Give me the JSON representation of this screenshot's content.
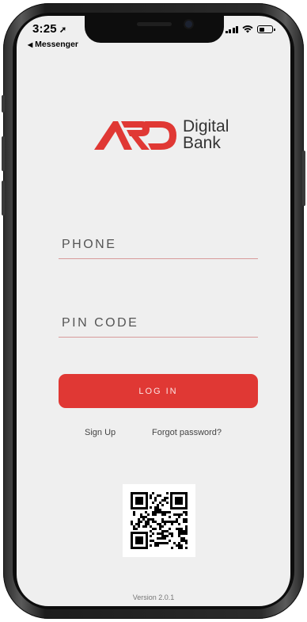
{
  "status_bar": {
    "time": "3:25",
    "location_arrow": "➚",
    "back_indicator": "◀",
    "back_app": "Messenger",
    "signal_icon": "cellular-signal-icon",
    "wifi_icon": "wifi-icon",
    "battery_icon": "battery-icon"
  },
  "brand": {
    "logo_letters": "ARD",
    "name_line1": "Digital",
    "name_line2": "Bank",
    "accent_color": "#e03834"
  },
  "form": {
    "phone_label": "PHONE",
    "pin_label": "PIN CODE",
    "login_label": "LOG IN"
  },
  "links": {
    "sign_up": "Sign Up",
    "forgot_password": "Forgot password?"
  },
  "footer": {
    "version": "Version 2.0.1"
  }
}
